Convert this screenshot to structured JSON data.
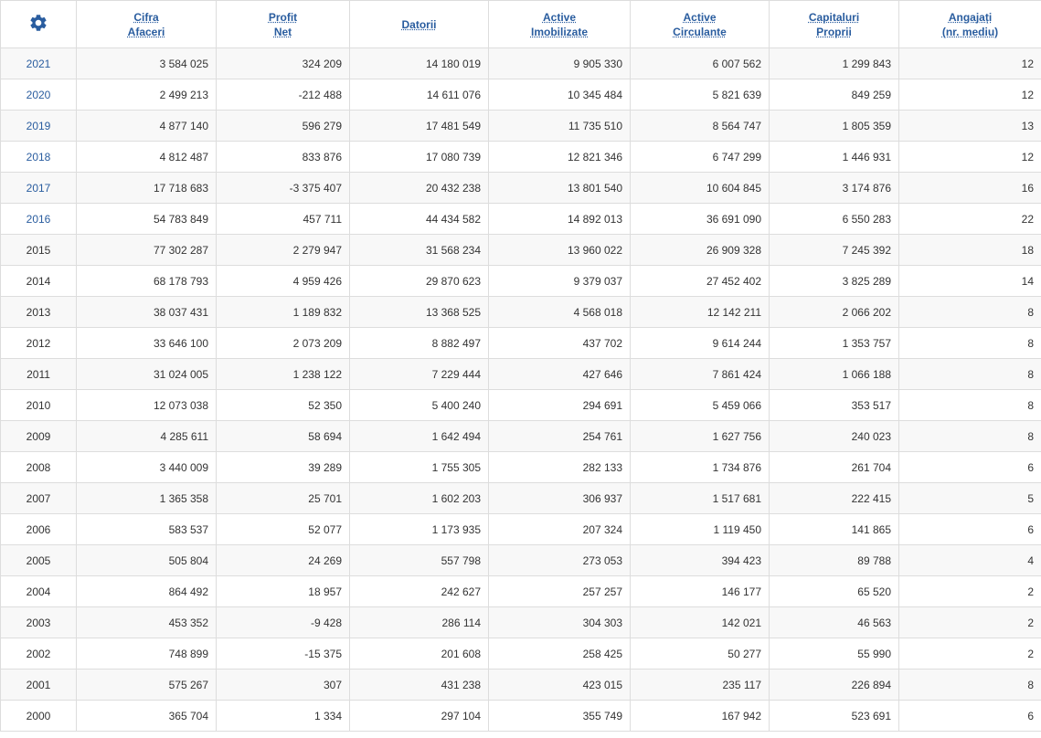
{
  "colors": {
    "accent": "#2a5d9f",
    "border": "#dddddd",
    "row_stripe": "#f8f8f8",
    "text": "#333333"
  },
  "settings_icon": "gear-icon",
  "columns": [
    "Cifra\nAfaceri",
    "Profit\nNet",
    "Datorii",
    "Active\nImobilizate",
    "Active\nCirculante",
    "Capitaluri\nProprii",
    "Angajați\n(nr. mediu)"
  ],
  "rows": [
    {
      "year": "2021",
      "link": true,
      "values": [
        "3 584 025",
        "324 209",
        "14 180 019",
        "9 905 330",
        "6 007 562",
        "1 299 843",
        "12"
      ]
    },
    {
      "year": "2020",
      "link": true,
      "values": [
        "2 499 213",
        "-212 488",
        "14 611 076",
        "10 345 484",
        "5 821 639",
        "849 259",
        "12"
      ]
    },
    {
      "year": "2019",
      "link": true,
      "values": [
        "4 877 140",
        "596 279",
        "17 481 549",
        "11 735 510",
        "8 564 747",
        "1 805 359",
        "13"
      ]
    },
    {
      "year": "2018",
      "link": true,
      "values": [
        "4 812 487",
        "833 876",
        "17 080 739",
        "12 821 346",
        "6 747 299",
        "1 446 931",
        "12"
      ]
    },
    {
      "year": "2017",
      "link": true,
      "values": [
        "17 718 683",
        "-3 375 407",
        "20 432 238",
        "13 801 540",
        "10 604 845",
        "3 174 876",
        "16"
      ]
    },
    {
      "year": "2016",
      "link": true,
      "values": [
        "54 783 849",
        "457 711",
        "44 434 582",
        "14 892 013",
        "36 691 090",
        "6 550 283",
        "22"
      ]
    },
    {
      "year": "2015",
      "link": false,
      "values": [
        "77 302 287",
        "2 279 947",
        "31 568 234",
        "13 960 022",
        "26 909 328",
        "7 245 392",
        "18"
      ]
    },
    {
      "year": "2014",
      "link": false,
      "values": [
        "68 178 793",
        "4 959 426",
        "29 870 623",
        "9 379 037",
        "27 452 402",
        "3 825 289",
        "14"
      ]
    },
    {
      "year": "2013",
      "link": false,
      "values": [
        "38 037 431",
        "1 189 832",
        "13 368 525",
        "4 568 018",
        "12 142 211",
        "2 066 202",
        "8"
      ]
    },
    {
      "year": "2012",
      "link": false,
      "values": [
        "33 646 100",
        "2 073 209",
        "8 882 497",
        "437 702",
        "9 614 244",
        "1 353 757",
        "8"
      ]
    },
    {
      "year": "2011",
      "link": false,
      "values": [
        "31 024 005",
        "1 238 122",
        "7 229 444",
        "427 646",
        "7 861 424",
        "1 066 188",
        "8"
      ]
    },
    {
      "year": "2010",
      "link": false,
      "values": [
        "12 073 038",
        "52 350",
        "5 400 240",
        "294 691",
        "5 459 066",
        "353 517",
        "8"
      ]
    },
    {
      "year": "2009",
      "link": false,
      "values": [
        "4 285 611",
        "58 694",
        "1 642 494",
        "254 761",
        "1 627 756",
        "240 023",
        "8"
      ]
    },
    {
      "year": "2008",
      "link": false,
      "values": [
        "3 440 009",
        "39 289",
        "1 755 305",
        "282 133",
        "1 734 876",
        "261 704",
        "6"
      ]
    },
    {
      "year": "2007",
      "link": false,
      "values": [
        "1 365 358",
        "25 701",
        "1 602 203",
        "306 937",
        "1 517 681",
        "222 415",
        "5"
      ]
    },
    {
      "year": "2006",
      "link": false,
      "values": [
        "583 537",
        "52 077",
        "1 173 935",
        "207 324",
        "1 119 450",
        "141 865",
        "6"
      ]
    },
    {
      "year": "2005",
      "link": false,
      "values": [
        "505 804",
        "24 269",
        "557 798",
        "273 053",
        "394 423",
        "89 788",
        "4"
      ]
    },
    {
      "year": "2004",
      "link": false,
      "values": [
        "864 492",
        "18 957",
        "242 627",
        "257 257",
        "146 177",
        "65 520",
        "2"
      ]
    },
    {
      "year": "2003",
      "link": false,
      "values": [
        "453 352",
        "-9 428",
        "286 114",
        "304 303",
        "142 021",
        "46 563",
        "2"
      ]
    },
    {
      "year": "2002",
      "link": false,
      "values": [
        "748 899",
        "-15 375",
        "201 608",
        "258 425",
        "50 277",
        "55 990",
        "2"
      ]
    },
    {
      "year": "2001",
      "link": false,
      "values": [
        "575 267",
        "307",
        "431 238",
        "423 015",
        "235 117",
        "226 894",
        "8"
      ]
    },
    {
      "year": "2000",
      "link": false,
      "values": [
        "365 704",
        "1 334",
        "297 104",
        "355 749",
        "167 942",
        "523 691",
        "6"
      ]
    }
  ]
}
